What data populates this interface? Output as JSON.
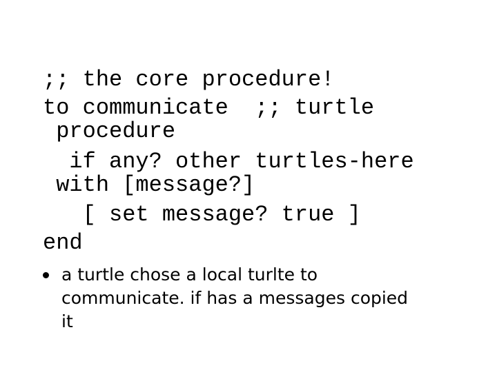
{
  "slide": {
    "code_lines": [
      ";; the core procedure!",
      "to communicate  ;; turtle",
      " procedure",
      "  if any? other turtles-here",
      " with [message?]",
      "   [ set message? true ]",
      "end"
    ],
    "bullets": [
      {
        "lines": [
          "a turtle chose a local turlte to",
          "communicate. if has a messages copied",
          "it"
        ]
      }
    ]
  }
}
